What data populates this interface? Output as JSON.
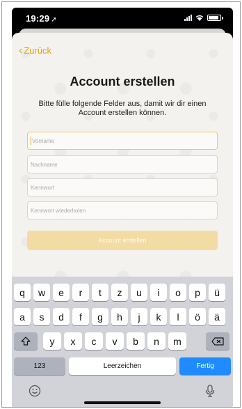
{
  "status_bar": {
    "time": "19:29"
  },
  "nav": {
    "back_label": "Zurück"
  },
  "form": {
    "title": "Account erstellen",
    "subtitle": "Bitte fülle folgende Felder aus, damit wir dir einen Account erstellen können.",
    "fields": [
      {
        "placeholder": "Vorname",
        "value": ""
      },
      {
        "placeholder": "Nachname",
        "value": ""
      },
      {
        "placeholder": "Kennwort",
        "value": ""
      },
      {
        "placeholder": "Kennwort wiederholen",
        "value": ""
      }
    ],
    "submit_label": "Account erstellen"
  },
  "keyboard": {
    "row1": [
      "q",
      "w",
      "e",
      "r",
      "t",
      "z",
      "u",
      "i",
      "o",
      "p",
      "ü"
    ],
    "row2": [
      "a",
      "s",
      "d",
      "f",
      "g",
      "h",
      "j",
      "k",
      "l",
      "ö",
      "ä"
    ],
    "row3": [
      "y",
      "x",
      "c",
      "v",
      "b",
      "n",
      "m"
    ],
    "numbers_label": "123",
    "space_label": "Leerzeichen",
    "return_label": "Fertig",
    "shift_icon": "shift-icon",
    "delete_icon": "backspace-icon",
    "emoji_icon": "emoji-icon",
    "mic_icon": "microphone-icon"
  },
  "colors": {
    "accent": "#e8a400",
    "keyboard_bg": "#d1d3d9",
    "return_key": "#1f8bff"
  }
}
